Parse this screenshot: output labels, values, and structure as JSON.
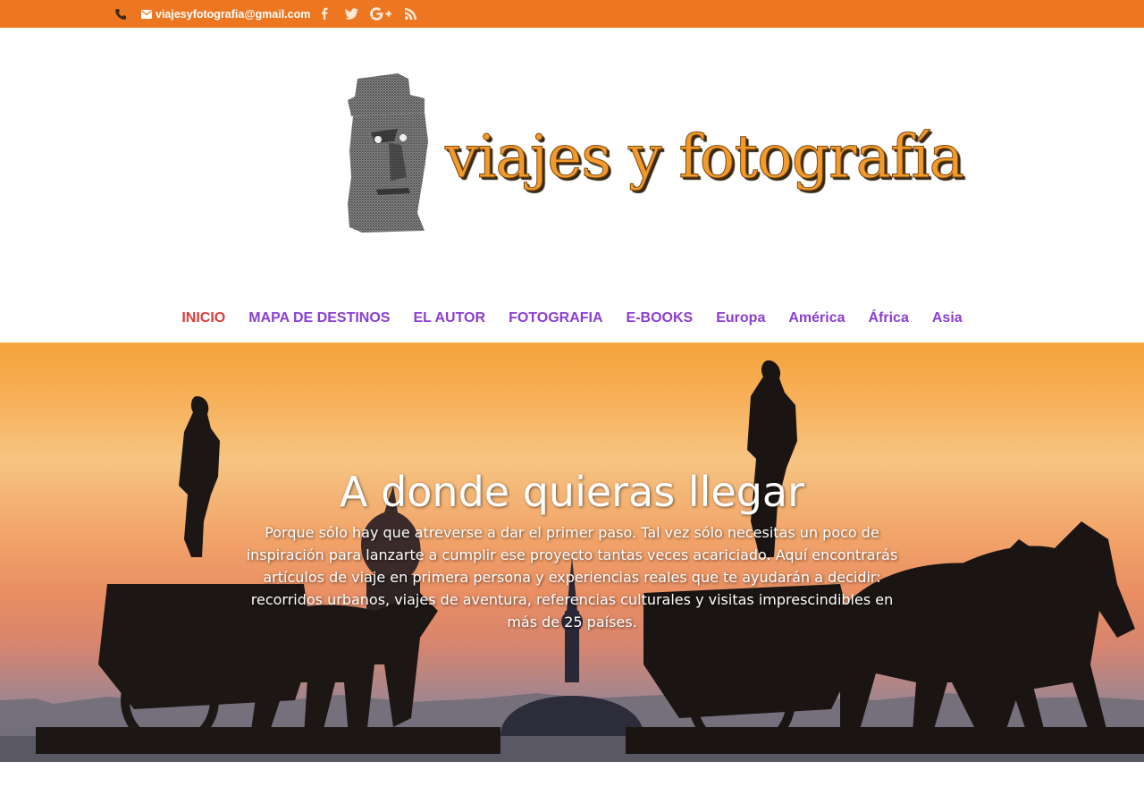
{
  "topbar": {
    "email": "viajesyfotografia@gmail.com",
    "icons": [
      "phone-icon",
      "envelope-icon",
      "facebook-icon",
      "twitter-icon",
      "google-plus-icon",
      "rss-icon"
    ],
    "background": "#ed7621"
  },
  "logo": {
    "text": "viajes y fotografía"
  },
  "nav": {
    "items": [
      {
        "label": "INICIO",
        "active": true
      },
      {
        "label": "MAPA DE DESTINOS"
      },
      {
        "label": "EL AUTOR"
      },
      {
        "label": "FOTOGRAFIA"
      },
      {
        "label": "E-BOOKS"
      },
      {
        "label": "Europa"
      },
      {
        "label": "América"
      },
      {
        "label": "África"
      },
      {
        "label": "Asia"
      }
    ],
    "color": "#8c3ed1",
    "active_color": "#e03a3a"
  },
  "hero": {
    "title": "A donde quieras llegar",
    "text": "Porque sólo hay que atreverse a dar el primer paso. Tal vez sólo necesitas un poco de inspiración para lanzarte a cumplir ese proyecto tantas veces acariciado. Aquí encontrarás artículos de viaje en primera persona y experiencias reales que te ayudarán a decidir: recorridos urbanos, viajes de aventura, referencias culturales y visitas imprescindibles en más de 25 países."
  }
}
